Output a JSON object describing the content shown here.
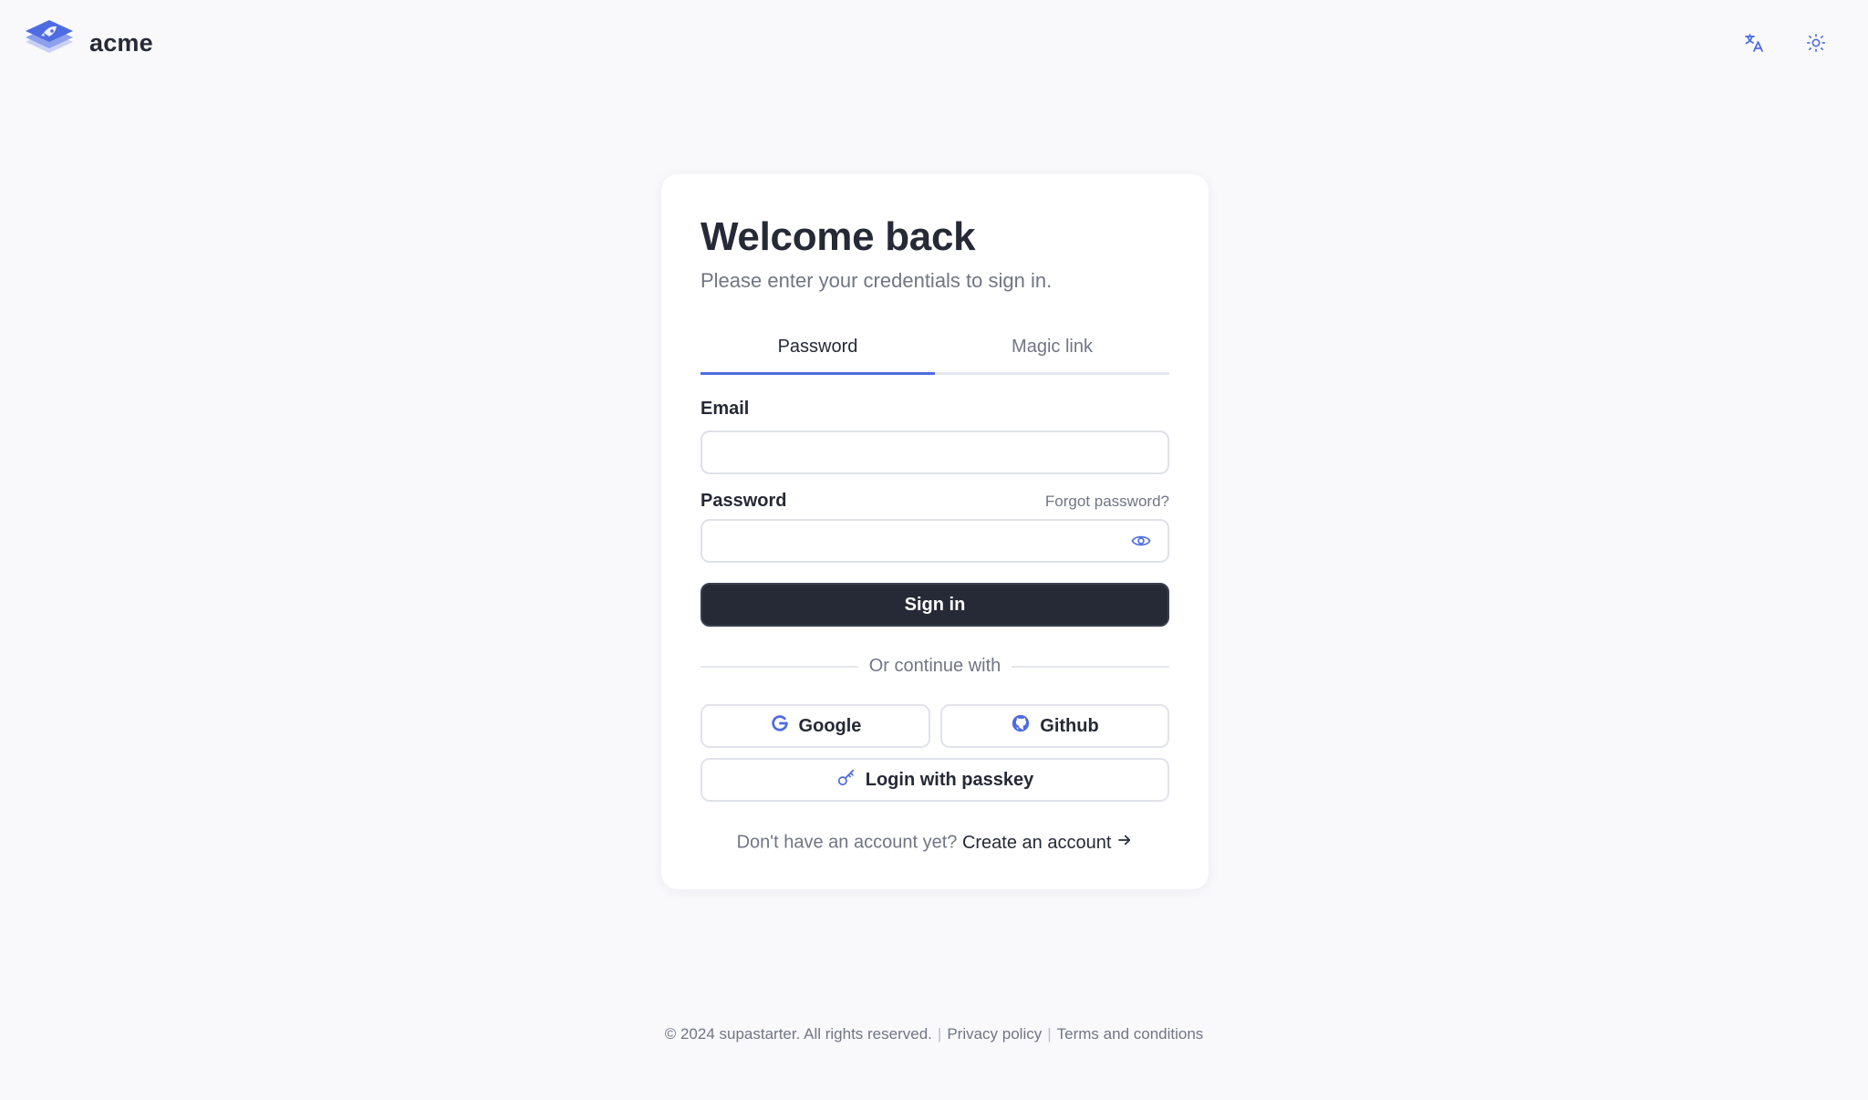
{
  "brand": {
    "name": "acme",
    "logo_icon": "layers-logo-icon"
  },
  "top_icons": {
    "language": "translate-icon",
    "theme": "sun-icon"
  },
  "card": {
    "title": "Welcome back",
    "subtitle": "Please enter your credentials to sign in.",
    "tabs": [
      {
        "label": "Password",
        "active": true
      },
      {
        "label": "Magic link",
        "active": false
      }
    ],
    "email_label": "Email",
    "email_value": "",
    "password_label": "Password",
    "password_value": "",
    "forgot_label": "Forgot password?",
    "signin_label": "Sign in",
    "divider_label": "Or continue with",
    "google_label": "Google",
    "github_label": "Github",
    "passkey_label": "Login with passkey",
    "no_account_text": "Don't have an account yet?",
    "create_account_label": "Create an account"
  },
  "footer": {
    "copyright": "© 2024 supastarter. All rights reserved.",
    "privacy": "Privacy policy",
    "terms": "Terms and conditions"
  },
  "colors": {
    "accent": "#4e6ce1",
    "primary": "#262a36",
    "muted": "#717584",
    "background": "#f9f9fc"
  }
}
